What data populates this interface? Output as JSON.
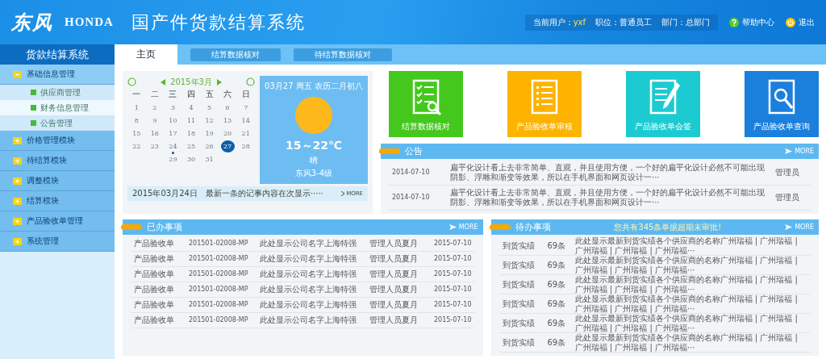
{
  "header": {
    "logo_cn": "东风",
    "logo_en": "HONDA",
    "title": "国产件货款结算系统",
    "user_label": "当前用户：",
    "user": "yxf",
    "position": "职位：普通员工",
    "department": "部门：总部门",
    "help": "帮助中心",
    "logout": "退出"
  },
  "sidebar": {
    "title": "货款结算系统",
    "groups": [
      {
        "label": "基础信息管理",
        "expanded": true,
        "children": [
          {
            "label": "供应商管理",
            "selected": false
          },
          {
            "label": "财务信息管理",
            "selected": true
          },
          {
            "label": "公告管理",
            "selected": false
          }
        ]
      },
      {
        "label": "价格管理模块",
        "expanded": false
      },
      {
        "label": "待结算模块",
        "expanded": false
      },
      {
        "label": "调整模块",
        "expanded": false
      },
      {
        "label": "结算模块",
        "expanded": false
      },
      {
        "label": "产品验收单管理",
        "expanded": false
      },
      {
        "label": "系统管理",
        "expanded": false
      }
    ]
  },
  "tabs": [
    {
      "label": "主页",
      "selected": true
    },
    {
      "label": "结算数据核对",
      "selected": false
    },
    {
      "label": "待结算数据核对",
      "selected": false
    }
  ],
  "calendar": {
    "month": "2015年3月",
    "weekdays": [
      "一",
      "二",
      "三",
      "四",
      "五",
      "六",
      "日"
    ],
    "weeks": [
      [
        {
          "day": "1",
          "selected": false,
          "event": false
        },
        {
          "day": "2",
          "selected": false,
          "event": false
        },
        {
          "day": "3",
          "selected": false,
          "event": false
        },
        {
          "day": "4",
          "selected": false,
          "event": false
        },
        {
          "day": "5",
          "selected": false,
          "event": false
        },
        {
          "day": "6",
          "selected": false,
          "event": false
        },
        {
          "day": "7",
          "selected": false,
          "event": false
        }
      ],
      [
        {
          "day": "8",
          "selected": false,
          "event": false
        },
        {
          "day": "9",
          "selected": false,
          "event": false
        },
        {
          "day": "10",
          "selected": false,
          "event": false
        },
        {
          "day": "11",
          "selected": false,
          "event": false
        },
        {
          "day": "12",
          "selected": false,
          "event": false
        },
        {
          "day": "13",
          "selected": false,
          "event": false
        },
        {
          "day": "14",
          "selected": false,
          "event": false
        }
      ],
      [
        {
          "day": "15",
          "selected": false,
          "event": false
        },
        {
          "day": "16",
          "selected": false,
          "event": false
        },
        {
          "day": "17",
          "selected": false,
          "event": false
        },
        {
          "day": "18",
          "selected": false,
          "event": false
        },
        {
          "day": "19",
          "selected": false,
          "event": false
        },
        {
          "day": "20",
          "selected": false,
          "event": false
        },
        {
          "day": "21",
          "selected": false,
          "event": false
        }
      ],
      [
        {
          "day": "22",
          "selected": false,
          "event": false
        },
        {
          "day": "23",
          "selected": false,
          "event": false
        },
        {
          "day": "24",
          "selected": false,
          "event": true
        },
        {
          "day": "25",
          "selected": false,
          "event": false
        },
        {
          "day": "26",
          "selected": false,
          "event": false
        },
        {
          "day": "27",
          "selected": true,
          "event": false
        },
        {
          "day": "28",
          "selected": false,
          "event": false
        }
      ],
      [
        {
          "kind": "blank"
        },
        {
          "kind": "blank"
        },
        {
          "day": "29",
          "selected": false,
          "event": false
        },
        {
          "day": "30",
          "selected": false,
          "event": false
        },
        {
          "day": "31",
          "selected": false,
          "event": false
        }
      ]
    ],
    "memo": {
      "date": "2015年03月24日",
      "text": "最新一条的记事内容在次显示·····",
      "more": "MORE"
    }
  },
  "weather": {
    "date": "03月27 周五 农历二月初八",
    "temp": "15～22℃",
    "condition": "晴",
    "wind": "东风3-4级"
  },
  "tiles": [
    {
      "label": "结算数据核对",
      "kind": "checklist",
      "color": "#44c81e"
    },
    {
      "label": "产品验收单审核",
      "kind": "list",
      "color": "#fdb300"
    },
    {
      "label": "产品验收单会签",
      "kind": "pen",
      "color": "#1ccbd2"
    },
    {
      "label": "产品验收单查询",
      "kind": "search",
      "color": "#1b7fdc"
    }
  ],
  "notice": {
    "title": "公告",
    "more": "MORE",
    "rows": [
      {
        "date": "2014-07-10",
        "text": "扁平化设计看上去非常简单、直观，并且使用方便，一个好的扁平化设计必然不可能出现阴影、浮雕和渐变等效果，所以在手机界面和网页设计一···",
        "author": "管理员"
      },
      {
        "date": "2014-07-10",
        "text": "扁平化设计看上去非常简单、直观，并且使用方便，一个好的扁平化设计必然不可能出现阴影、浮雕和渐变等效果，所以在手机界面和网页设计一···",
        "author": "管理员"
      }
    ]
  },
  "done": {
    "title": "已办事项",
    "more": "MORE",
    "rows": [
      {
        "type": "产品验收单",
        "code": "201501-02008-MP",
        "company": "此处显示公司名字上海特强",
        "person": "管理人员夏月",
        "date": "2015-07-10"
      },
      {
        "type": "产品验收单",
        "code": "201501-02008-MP",
        "company": "此处显示公司名字上海特强",
        "person": "管理人员夏月",
        "date": "2015-07-10"
      },
      {
        "type": "产品验收单",
        "code": "201501-02008-MP",
        "company": "此处显示公司名字上海特强",
        "person": "管理人员夏月",
        "date": "2015-07-10"
      },
      {
        "type": "产品验收单",
        "code": "201501-02008-MP",
        "company": "此处显示公司名字上海特强",
        "person": "管理人员夏月",
        "date": "2015-07-10"
      },
      {
        "type": "产品验收单",
        "code": "201501-02008-MP",
        "company": "此处显示公司名字上海特强",
        "person": "管理人员夏月",
        "date": "2015-07-10"
      },
      {
        "type": "产品验收单",
        "code": "201501-02008-MP",
        "company": "此处显示公司名字上海特强",
        "person": "管理人员夏月",
        "date": "2015-07-10"
      }
    ]
  },
  "todo": {
    "title": "待办事项",
    "alert": "您共有345条单据超期未审批!",
    "more": "MORE",
    "rows": [
      {
        "type": "到货实绩",
        "count": "69条",
        "text": "此处显示最新到货实绩各个供应商的名称广州瑞福 | 广州瑞福 | 广州瑞福 | 广州瑞福 | 广州瑞福···"
      },
      {
        "type": "到货实绩",
        "count": "69条",
        "text": "此处显示最新到货实绩各个供应商的名称广州瑞福 | 广州瑞福 | 广州瑞福 | 广州瑞福 | 广州瑞福···"
      },
      {
        "type": "到货实绩",
        "count": "69条",
        "text": "此处显示最新到货实绩各个供应商的名称广州瑞福 | 广州瑞福 | 广州瑞福 | 广州瑞福 | 广州瑞福···"
      },
      {
        "type": "到货实绩",
        "count": "69条",
        "text": "此处显示最新到货实绩各个供应商的名称广州瑞福 | 广州瑞福 | 广州瑞福 | 广州瑞福 | 广州瑞福···"
      },
      {
        "type": "到货实绩",
        "count": "69条",
        "text": "此处显示最新到货实绩各个供应商的名称广州瑞福 | 广州瑞福 | 广州瑞福 | 广州瑞福 | 广州瑞福···"
      },
      {
        "type": "到货实绩",
        "count": "69条",
        "text": "此处显示最新到货实绩各个供应商的名称广州瑞福 | 广州瑞福 | 广州瑞福 | 广州瑞福 | 广州瑞福···"
      }
    ]
  }
}
